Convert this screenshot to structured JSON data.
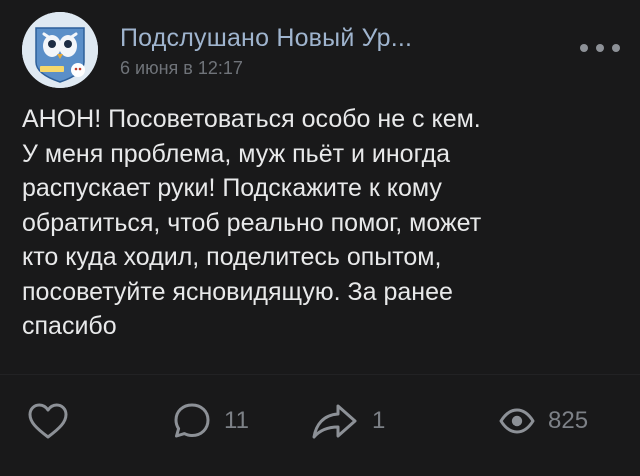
{
  "post": {
    "group_name": "Подслушано Новый Ур...",
    "date": "6 июня в 12:17",
    "text": "АНОН! Посоветоваться особо не с кем.\nУ меня проблема, муж пьёт и иногда\nраспускает руки! Подскажите к кому\nобратиться, чтоб реально помог, может\nкто куда ходил, поделитесь опытом,\nпосоветуйте ясновидящую. За ранее\nспасибо",
    "avatar_icon": "owl-logo-avatar"
  },
  "actions": {
    "like_icon": "heart-icon",
    "comment_icon": "comment-icon",
    "comments_count": "11",
    "share_icon": "share-icon",
    "shares_count": "1",
    "views_icon": "eye-icon",
    "views_count": "825"
  },
  "colors": {
    "background": "#19191a",
    "group_name": "#9fb4ce",
    "muted": "#7d8187"
  }
}
